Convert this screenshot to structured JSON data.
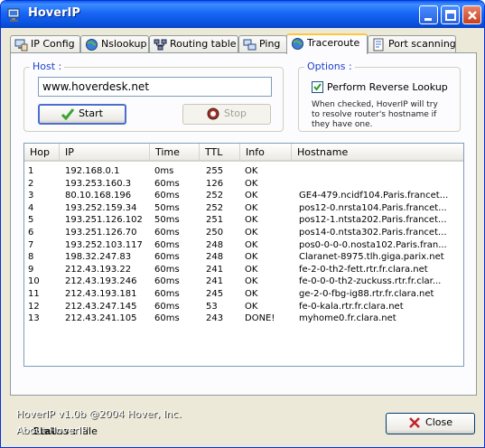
{
  "window": {
    "title": "HoverIP"
  },
  "tabs": [
    {
      "label": "IP Config"
    },
    {
      "label": "Nslookup"
    },
    {
      "label": "Routing table"
    },
    {
      "label": "Ping"
    },
    {
      "label": "Traceroute"
    },
    {
      "label": "Port scanning"
    }
  ],
  "host": {
    "group_label": "Host :",
    "value": "www.hoverdesk.net",
    "start_label": "Start",
    "stop_label": "Stop"
  },
  "options": {
    "group_label": "Options :",
    "reverse_lookup_label": "Perform Reverse Lookup",
    "reverse_lookup_checked": true,
    "hint_line1": "When checked, HoverIP will try",
    "hint_line2": "to resolve router's hostname if",
    "hint_line3": "they have one."
  },
  "table": {
    "columns": [
      "Hop",
      "IP",
      "Time",
      "TTL",
      "Info",
      "Hostname"
    ],
    "rows": [
      [
        "1",
        "192.168.0.1",
        "0ms",
        "255",
        "OK",
        ""
      ],
      [
        "2",
        "193.253.160.3",
        "60ms",
        "126",
        "OK",
        ""
      ],
      [
        "3",
        "80.10.168.196",
        "60ms",
        "252",
        "OK",
        "GE4-479.ncidf104.Paris.francet..."
      ],
      [
        "4",
        "193.252.159.34",
        "50ms",
        "252",
        "OK",
        "pos12-0.nrsta104.Paris.francet..."
      ],
      [
        "5",
        "193.251.126.102",
        "50ms",
        "251",
        "OK",
        "pos12-1.ntsta202.Paris.francet..."
      ],
      [
        "6",
        "193.251.126.70",
        "60ms",
        "250",
        "OK",
        "pos14-0.ntsta302.Paris.francet..."
      ],
      [
        "7",
        "193.252.103.117",
        "60ms",
        "248",
        "OK",
        "pos0-0-0-0.nosta102.Paris.fran..."
      ],
      [
        "8",
        "198.32.247.83",
        "60ms",
        "248",
        "OK",
        "Claranet-8975.tlh.giga.parix.net"
      ],
      [
        "9",
        "212.43.193.22",
        "60ms",
        "241",
        "OK",
        "fe-2-0-th2-fett.rtr.fr.clara.net"
      ],
      [
        "10",
        "212.43.193.246",
        "60ms",
        "241",
        "OK",
        "fe-0-0-0-th2-zuckuss.rtr.fr.clar..."
      ],
      [
        "11",
        "212.43.193.181",
        "60ms",
        "245",
        "OK",
        "ge-2-0-fbg-ig88.rtr.fr.clara.net"
      ],
      [
        "12",
        "212.43.247.145",
        "60ms",
        "53",
        "OK",
        "fe-0-kala.rtr.fr.clara.net"
      ],
      [
        "13",
        "212.43.241.105",
        "60ms",
        "243",
        "DONE!",
        "myhome0.fr.clara.net"
      ]
    ]
  },
  "status": {
    "label": "Status :",
    "value": "idle"
  },
  "footer": {
    "copyright": "HoverIP v1.0b @2004 Hover, Inc.",
    "about": "About HoverIP",
    "close_label": "Close"
  },
  "colors": {
    "titlebar": "#0a54e0",
    "group_label": "#1c3fd0",
    "active_tab_accent": "#ffc83c",
    "close_icon": "#c0272d",
    "start_icon": "#3aa52e"
  },
  "icons": {
    "app": "app-icon",
    "tabs": [
      "ip-config-icon",
      "nslookup-globe-icon",
      "routing-table-icon",
      "ping-icon",
      "traceroute-globe-icon",
      "port-scanning-icon"
    ],
    "start": "checkmark-icon",
    "stop": "stop-icon",
    "close": "x-icon"
  }
}
